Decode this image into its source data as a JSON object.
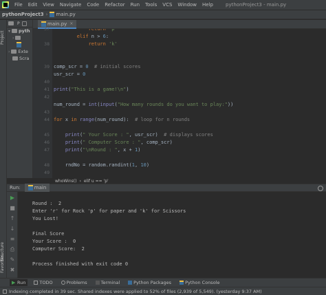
{
  "menubar": {
    "items": [
      "File",
      "Edit",
      "View",
      "Navigate",
      "Code",
      "Refactor",
      "Run",
      "Tools",
      "VCS",
      "Window",
      "Help"
    ],
    "window_title": "pythonProject3 - main.py"
  },
  "navbar": {
    "project": "pythonProject3",
    "file": "main.py"
  },
  "left_strip": {
    "project_tab": "Project",
    "structure_tab": "Structure",
    "favorites_tab": "Favorites"
  },
  "project_panel": {
    "items": [
      {
        "label": "pyth",
        "arrow": "▾"
      },
      {
        "label": "",
        "arrow": "›"
      },
      {
        "label": "",
        "arrow": ""
      },
      {
        "label": "Exte",
        "arrow": "›"
      },
      {
        "label": "Scra",
        "arrow": ""
      }
    ]
  },
  "editor": {
    "tab_label": "main.py",
    "tab_close": "×",
    "line_numbers": [
      "37",
      "38",
      "39",
      "40",
      "41",
      "42",
      "43",
      "44",
      "45",
      "46",
      "47",
      "48",
      "49",
      "50",
      "51",
      "52"
    ],
    "lines": [
      {
        "tokens": [
          {
            "t": "            ",
            "c": ""
          },
          {
            "t": "return",
            "c": "kw"
          },
          {
            "t": " ",
            "c": ""
          },
          {
            "t": "'p'",
            "c": "str"
          }
        ]
      },
      {
        "tokens": [
          {
            "t": "        ",
            "c": ""
          },
          {
            "t": "elif",
            "c": "kw"
          },
          {
            "t": " n > ",
            "c": ""
          },
          {
            "t": "6",
            "c": "num"
          },
          {
            "t": ":",
            "c": ""
          }
        ]
      },
      {
        "tokens": [
          {
            "t": "            ",
            "c": ""
          },
          {
            "t": "return",
            "c": "kw"
          },
          {
            "t": " ",
            "c": ""
          },
          {
            "t": "'k'",
            "c": "str"
          }
        ]
      },
      {
        "tokens": [
          {
            "t": "",
            "c": ""
          }
        ]
      },
      {
        "tokens": [
          {
            "t": "",
            "c": ""
          }
        ]
      },
      {
        "tokens": [
          {
            "t": "comp_scr = ",
            "c": ""
          },
          {
            "t": "0",
            "c": "num"
          },
          {
            "t": "  ",
            "c": ""
          },
          {
            "t": "# initial scores",
            "c": "com"
          }
        ]
      },
      {
        "tokens": [
          {
            "t": "usr_scr = ",
            "c": ""
          },
          {
            "t": "0",
            "c": "num"
          }
        ]
      },
      {
        "tokens": [
          {
            "t": "",
            "c": ""
          }
        ]
      },
      {
        "tokens": [
          {
            "t": "print",
            "c": "fn"
          },
          {
            "t": "(",
            "c": ""
          },
          {
            "t": "\"This is a game!\\n\"",
            "c": "str"
          },
          {
            "t": ")",
            "c": ""
          }
        ]
      },
      {
        "tokens": [
          {
            "t": "",
            "c": ""
          }
        ]
      },
      {
        "tokens": [
          {
            "t": "num_round = ",
            "c": ""
          },
          {
            "t": "int",
            "c": "fn"
          },
          {
            "t": "(",
            "c": ""
          },
          {
            "t": "input",
            "c": "fn"
          },
          {
            "t": "(",
            "c": ""
          },
          {
            "t": "\"How many rounds do you want to play:\"",
            "c": "str"
          },
          {
            "t": "))",
            "c": ""
          }
        ]
      },
      {
        "tokens": [
          {
            "t": "",
            "c": ""
          }
        ]
      },
      {
        "tokens": [
          {
            "t": "for",
            "c": "kw"
          },
          {
            "t": " x ",
            "c": ""
          },
          {
            "t": "in",
            "c": "kw"
          },
          {
            "t": " ",
            "c": ""
          },
          {
            "t": "range",
            "c": "fn"
          },
          {
            "t": "(num_round):  ",
            "c": ""
          },
          {
            "t": "# loop for n rounds",
            "c": "com"
          }
        ]
      },
      {
        "tokens": [
          {
            "t": "",
            "c": ""
          }
        ]
      },
      {
        "tokens": [
          {
            "t": "    ",
            "c": ""
          },
          {
            "t": "print",
            "c": "fn"
          },
          {
            "t": "(",
            "c": ""
          },
          {
            "t": "\" Your Score : \"",
            "c": "str"
          },
          {
            "t": ", usr_scr)  ",
            "c": ""
          },
          {
            "t": "# displays scores",
            "c": "com"
          }
        ]
      },
      {
        "tokens": [
          {
            "t": "    ",
            "c": ""
          },
          {
            "t": "print",
            "c": "fn"
          },
          {
            "t": "(",
            "c": ""
          },
          {
            "t": "\" Computer Score : \"",
            "c": "str"
          },
          {
            "t": ", comp_scr)",
            "c": ""
          }
        ]
      },
      {
        "tokens": [
          {
            "t": "    ",
            "c": ""
          },
          {
            "t": "print",
            "c": "fn"
          },
          {
            "t": "(",
            "c": ""
          },
          {
            "t": "\"\\nRound : \"",
            "c": "str"
          },
          {
            "t": ", x + ",
            "c": ""
          },
          {
            "t": "1",
            "c": "num"
          },
          {
            "t": ")",
            "c": ""
          }
        ]
      },
      {
        "tokens": [
          {
            "t": "",
            "c": ""
          }
        ]
      },
      {
        "tokens": [
          {
            "t": "    rndNo = random.randint(",
            "c": ""
          },
          {
            "t": "1",
            "c": "num"
          },
          {
            "t": ", ",
            "c": ""
          },
          {
            "t": "10",
            "c": "num"
          },
          {
            "t": ")",
            "c": ""
          }
        ]
      }
    ],
    "breadcrumb": [
      "whoWins()",
      "›",
      "elif u == 'p'"
    ]
  },
  "run_panel": {
    "label": "Run:",
    "tab": "main",
    "console_lines": [
      "Round :  2",
      "Enter 'r' for Rock 'p' for paper and 'k' for Scissors",
      "You Lost!",
      "",
      "Final Score",
      "Your Score :  0",
      "Computer Score:  2",
      "",
      "Process finished with exit code 0"
    ]
  },
  "bottom_tabs": {
    "items": [
      "Run",
      "TODO",
      "Problems",
      "Terminal",
      "Python Packages",
      "Python Console"
    ]
  },
  "status_bar": {
    "text": "Indexing completed in 39 sec. Shared indexes were applied to 52% of files (2,939 of 5,549). (yesterday 9:37 AM)"
  },
  "colors": {
    "accent": "#4a88c7",
    "run_green": "#499c54",
    "stop_red": "#c75450"
  }
}
